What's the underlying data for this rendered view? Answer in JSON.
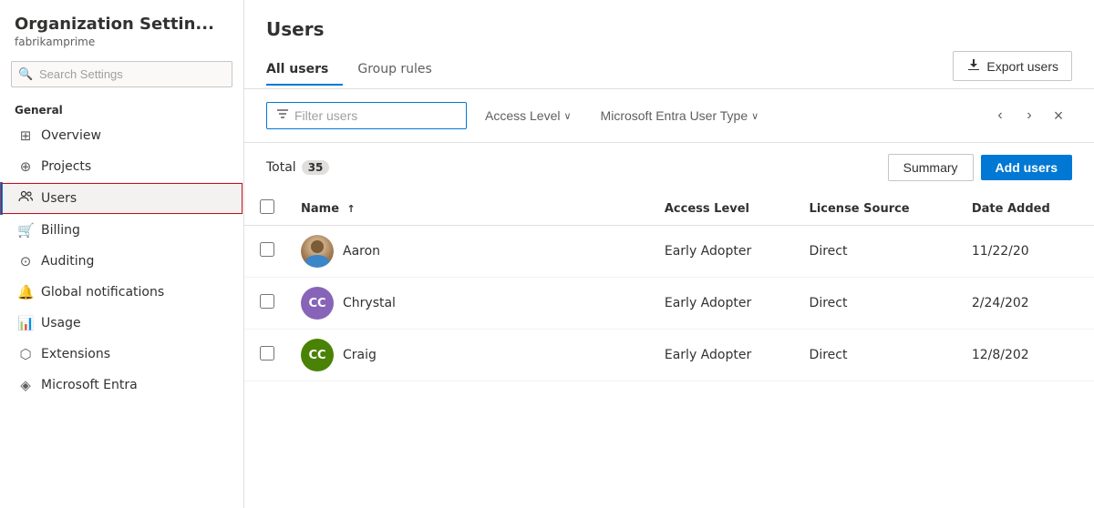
{
  "sidebar": {
    "title": "Organization Settin...",
    "subtitle": "fabrikamprime",
    "search_placeholder": "Search Settings",
    "section_general": "General",
    "items": [
      {
        "id": "overview",
        "label": "Overview",
        "icon": "⊞"
      },
      {
        "id": "projects",
        "label": "Projects",
        "icon": "⊕"
      },
      {
        "id": "users",
        "label": "Users",
        "icon": "👥",
        "active": true
      },
      {
        "id": "billing",
        "label": "Billing",
        "icon": "🛒"
      },
      {
        "id": "auditing",
        "label": "Auditing",
        "icon": "⊙"
      },
      {
        "id": "global-notifications",
        "label": "Global notifications",
        "icon": "🔔"
      },
      {
        "id": "usage",
        "label": "Usage",
        "icon": "📊"
      },
      {
        "id": "extensions",
        "label": "Extensions",
        "icon": "⬡"
      },
      {
        "id": "microsoft-entra",
        "label": "Microsoft Entra",
        "icon": "◈"
      }
    ]
  },
  "main": {
    "title": "Users",
    "tabs": [
      {
        "id": "all-users",
        "label": "All users",
        "active": true
      },
      {
        "id": "group-rules",
        "label": "Group rules",
        "active": false
      }
    ],
    "export_button": "Export users",
    "filter": {
      "placeholder": "Filter users",
      "access_level_label": "Access Level",
      "user_type_label": "Microsoft Entra User Type"
    },
    "table": {
      "total_label": "Total",
      "total_count": "35",
      "summary_button": "Summary",
      "add_users_button": "Add users",
      "columns": [
        {
          "id": "checkbox",
          "label": ""
        },
        {
          "id": "name",
          "label": "Name",
          "sort": "↑"
        },
        {
          "id": "access-level",
          "label": "Access Level"
        },
        {
          "id": "license-source",
          "label": "License Source"
        },
        {
          "id": "date-added",
          "label": "Date Added"
        }
      ],
      "rows": [
        {
          "id": "aaron",
          "name": "Aaron",
          "avatar_type": "photo",
          "avatar_initials": "",
          "avatar_color": "",
          "access_level": "Early Adopter",
          "license_source": "Direct",
          "date_added": "11/22/20"
        },
        {
          "id": "chrystal",
          "name": "Chrystal",
          "avatar_type": "initials",
          "avatar_initials": "CC",
          "avatar_color": "purple",
          "access_level": "Early Adopter",
          "license_source": "Direct",
          "date_added": "2/24/202"
        },
        {
          "id": "craig",
          "name": "Craig",
          "avatar_type": "initials",
          "avatar_initials": "CC",
          "avatar_color": "green",
          "access_level": "Early Adopter",
          "license_source": "Direct",
          "date_added": "12/8/202"
        }
      ]
    }
  }
}
